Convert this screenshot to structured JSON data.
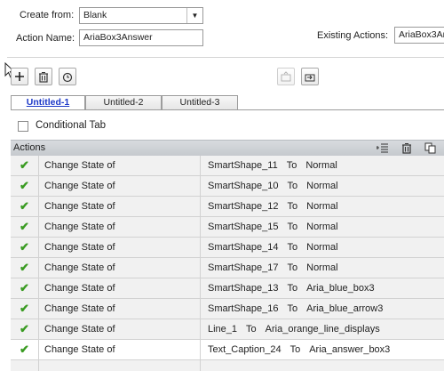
{
  "form": {
    "create_from_label": "Create from:",
    "create_from_value": "Blank",
    "action_name_label": "Action Name:",
    "action_name_value": "AriaBox3Answer",
    "existing_actions_label": "Existing Actions:",
    "existing_actions_value": "AriaBox3An"
  },
  "tabs": [
    "Untitled-1",
    "Untitled-2",
    "Untitled-3"
  ],
  "conditional_tab_label": "Conditional Tab",
  "actions_header": "Actions",
  "rows": [
    {
      "action": "Change State of",
      "target": "SmartShape_11",
      "to": "To",
      "state": "Normal"
    },
    {
      "action": "Change State of",
      "target": "SmartShape_10",
      "to": "To",
      "state": "Normal"
    },
    {
      "action": "Change State of",
      "target": "SmartShape_12",
      "to": "To",
      "state": "Normal"
    },
    {
      "action": "Change State of",
      "target": "SmartShape_15",
      "to": "To",
      "state": "Normal"
    },
    {
      "action": "Change State of",
      "target": "SmartShape_14",
      "to": "To",
      "state": "Normal"
    },
    {
      "action": "Change State of",
      "target": "SmartShape_17",
      "to": "To",
      "state": "Normal"
    },
    {
      "action": "Change State of",
      "target": "SmartShape_13",
      "to": "To",
      "state": "Aria_blue_box3"
    },
    {
      "action": "Change State of",
      "target": "SmartShape_16",
      "to": "To",
      "state": "Aria_blue_arrow3"
    },
    {
      "action": "Change State of",
      "target": "Line_1",
      "to": "To",
      "state": "Aria_orange_line_displays"
    },
    {
      "action": "Change State of",
      "target": "Text_Caption_24",
      "to": "To",
      "state": "Aria_answer_box3"
    }
  ],
  "colors": {
    "active_tab_text": "#1d39c8",
    "check": "#3a9b22",
    "header_bg": "#c9cdd2"
  }
}
